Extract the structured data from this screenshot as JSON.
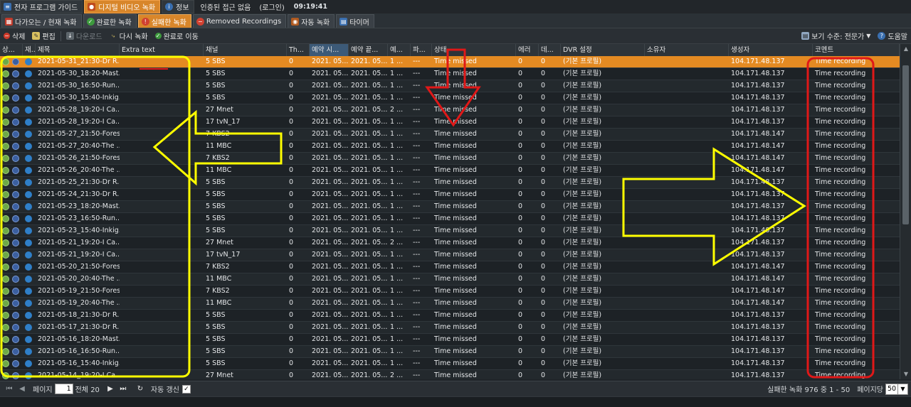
{
  "topnav": {
    "items": [
      {
        "label": "전자 프로그램 가이드",
        "icon": "tv-guide-icon",
        "active": false
      },
      {
        "label": "디지털 비디오 녹화",
        "icon": "dvr-icon",
        "active": true
      },
      {
        "label": "정보",
        "icon": "info-icon",
        "active": false
      }
    ],
    "auth_status": "인증된 접근 없음",
    "login_label": "(로그인)",
    "clock": "09:19:41"
  },
  "subtabs": [
    {
      "label": "다가오는 / 현재 녹화",
      "icon": "calendar-icon",
      "active": false
    },
    {
      "label": "완료한 녹화",
      "icon": "check-icon",
      "active": false
    },
    {
      "label": "실패한 녹화",
      "icon": "warning-icon",
      "active": true
    },
    {
      "label": "Removed Recordings",
      "icon": "removed-icon",
      "active": false
    },
    {
      "label": "자동 녹화",
      "icon": "autorec-icon",
      "active": false
    },
    {
      "label": "타이머",
      "icon": "timer-icon",
      "active": false
    }
  ],
  "toolbar": {
    "delete": "삭제",
    "edit": "편집",
    "download": "다운로드",
    "rerecord": "다시 녹화",
    "move_completed": "완료로 이동",
    "view_level": "보기 수준: 전문가",
    "help": "도움말"
  },
  "columns": [
    {
      "key": "status",
      "label": "상..."
    },
    {
      "key": "rec",
      "label": "재..."
    },
    {
      "key": "title",
      "label": "제목"
    },
    {
      "key": "extra",
      "label": "Extra text"
    },
    {
      "key": "channel",
      "label": "채널"
    },
    {
      "key": "th",
      "label": "Th..."
    },
    {
      "key": "start",
      "label": "예약 시..."
    },
    {
      "key": "end",
      "label": "예약 끝..."
    },
    {
      "key": "c9",
      "label": "예..."
    },
    {
      "key": "c10",
      "label": "파..."
    },
    {
      "key": "status_text",
      "label": "상태"
    },
    {
      "key": "err",
      "label": "에러"
    },
    {
      "key": "data",
      "label": "데..."
    },
    {
      "key": "dvr",
      "label": "DVR 설정"
    },
    {
      "key": "owner",
      "label": "소유자"
    },
    {
      "key": "creator",
      "label": "생성자"
    },
    {
      "key": "comment",
      "label": "코멘트"
    }
  ],
  "rows": [
    {
      "title": "2021-05-31_21:30-Dr R...",
      "channel": "5 SBS",
      "th": "0",
      "start": "2021. 05...",
      "end": "2021. 05...",
      "c9": "1 ...",
      "c10": "---",
      "status": "Time missed",
      "err": "0",
      "data": "0",
      "dvr": "(기본 프로필)",
      "creator": "104.171.48.137",
      "comment": "Time recording",
      "selected": true
    },
    {
      "title": "2021-05-30_18:20-Mast...",
      "channel": "5 SBS",
      "th": "0",
      "start": "2021. 05...",
      "end": "2021. 05...",
      "c9": "1 ...",
      "c10": "---",
      "status": "Time missed",
      "err": "0",
      "data": "0",
      "dvr": "(기본 프로필)",
      "creator": "104.171.48.137",
      "comment": "Time recording"
    },
    {
      "title": "2021-05-30_16:50-Run...",
      "channel": "5 SBS",
      "th": "0",
      "start": "2021. 05...",
      "end": "2021. 05...",
      "c9": "1 ...",
      "c10": "---",
      "status": "Time missed",
      "err": "0",
      "data": "0",
      "dvr": "(기본 프로필)",
      "creator": "104.171.48.137",
      "comment": "Time recording"
    },
    {
      "title": "2021-05-30_15:40-Inkig...",
      "channel": "5 SBS",
      "th": "0",
      "start": "2021. 05...",
      "end": "2021. 05...",
      "c9": "1 ...",
      "c10": "---",
      "status": "Time missed",
      "err": "0",
      "data": "0",
      "dvr": "(기본 프로필)",
      "creator": "104.171.48.137",
      "comment": "Time recording"
    },
    {
      "title": "2021-05-28_19:20-I Ca...",
      "channel": "27 Mnet",
      "th": "0",
      "start": "2021. 05...",
      "end": "2021. 05...",
      "c9": "2 ...",
      "c10": "---",
      "status": "Time missed",
      "err": "0",
      "data": "0",
      "dvr": "(기본 프로필)",
      "creator": "104.171.48.137",
      "comment": "Time recording"
    },
    {
      "title": "2021-05-28_19:20-I Ca...",
      "channel": "17 tvN_17",
      "th": "0",
      "start": "2021. 05...",
      "end": "2021. 05...",
      "c9": "1 ...",
      "c10": "---",
      "status": "Time missed",
      "err": "0",
      "data": "0",
      "dvr": "(기본 프로필)",
      "creator": "104.171.48.137",
      "comment": "Time recording"
    },
    {
      "title": "2021-05-27_21:50-Forest",
      "channel": "7 KBS2",
      "th": "0",
      "start": "2021. 05...",
      "end": "2021. 05...",
      "c9": "1 ...",
      "c10": "---",
      "status": "Time missed",
      "err": "0",
      "data": "0",
      "dvr": "(기본 프로필)",
      "creator": "104.171.48.147",
      "comment": "Time recording"
    },
    {
      "title": "2021-05-27_20:40-The ...",
      "channel": "11 MBC",
      "th": "0",
      "start": "2021. 05...",
      "end": "2021. 05...",
      "c9": "1 ...",
      "c10": "---",
      "status": "Time missed",
      "err": "0",
      "data": "0",
      "dvr": "(기본 프로필)",
      "creator": "104.171.48.147",
      "comment": "Time recording"
    },
    {
      "title": "2021-05-26_21:50-Forest",
      "channel": "7 KBS2",
      "th": "0",
      "start": "2021. 05...",
      "end": "2021. 05...",
      "c9": "1 ...",
      "c10": "---",
      "status": "Time missed",
      "err": "0",
      "data": "0",
      "dvr": "(기본 프로필)",
      "creator": "104.171.48.147",
      "comment": "Time recording"
    },
    {
      "title": "2021-05-26_20:40-The ...",
      "channel": "11 MBC",
      "th": "0",
      "start": "2021. 05...",
      "end": "2021. 05...",
      "c9": "1 ...",
      "c10": "---",
      "status": "Time missed",
      "err": "0",
      "data": "0",
      "dvr": "(기본 프로필)",
      "creator": "104.171.48.147",
      "comment": "Time recording"
    },
    {
      "title": "2021-05-25_21:30-Dr R...",
      "channel": "5 SBS",
      "th": "0",
      "start": "2021. 05...",
      "end": "2021. 05...",
      "c9": "1 ...",
      "c10": "---",
      "status": "Time missed",
      "err": "0",
      "data": "0",
      "dvr": "(기본 프로필)",
      "creator": "104.171.48.137",
      "comment": "Time recording"
    },
    {
      "title": "2021-05-24_21:30-Dr R...",
      "channel": "5 SBS",
      "th": "0",
      "start": "2021. 05...",
      "end": "2021. 05...",
      "c9": "1 ...",
      "c10": "---",
      "status": "Time missed",
      "err": "0",
      "data": "0",
      "dvr": "(기본 프로필)",
      "creator": "104.171.48.137",
      "comment": "Time recording"
    },
    {
      "title": "2021-05-23_18:20-Mast...",
      "channel": "5 SBS",
      "th": "0",
      "start": "2021. 05...",
      "end": "2021. 05...",
      "c9": "1 ...",
      "c10": "---",
      "status": "Time missed",
      "err": "0",
      "data": "0",
      "dvr": "(기본 프로필)",
      "creator": "104.171.48.137",
      "comment": "Time recording"
    },
    {
      "title": "2021-05-23_16:50-Run...",
      "channel": "5 SBS",
      "th": "0",
      "start": "2021. 05...",
      "end": "2021. 05...",
      "c9": "1 ...",
      "c10": "---",
      "status": "Time missed",
      "err": "0",
      "data": "0",
      "dvr": "(기본 프로필)",
      "creator": "104.171.48.137",
      "comment": "Time recording"
    },
    {
      "title": "2021-05-23_15:40-Inkig...",
      "channel": "5 SBS",
      "th": "0",
      "start": "2021. 05...",
      "end": "2021. 05...",
      "c9": "1 ...",
      "c10": "---",
      "status": "Time missed",
      "err": "0",
      "data": "0",
      "dvr": "(기본 프로필)",
      "creator": "104.171.48.137",
      "comment": "Time recording"
    },
    {
      "title": "2021-05-21_19:20-I Ca...",
      "channel": "27 Mnet",
      "th": "0",
      "start": "2021. 05...",
      "end": "2021. 05...",
      "c9": "2 ...",
      "c10": "---",
      "status": "Time missed",
      "err": "0",
      "data": "0",
      "dvr": "(기본 프로필)",
      "creator": "104.171.48.137",
      "comment": "Time recording"
    },
    {
      "title": "2021-05-21_19:20-I Ca...",
      "channel": "17 tvN_17",
      "th": "0",
      "start": "2021. 05...",
      "end": "2021. 05...",
      "c9": "1 ...",
      "c10": "---",
      "status": "Time missed",
      "err": "0",
      "data": "0",
      "dvr": "(기본 프로필)",
      "creator": "104.171.48.137",
      "comment": "Time recording"
    },
    {
      "title": "2021-05-20_21:50-Forest",
      "channel": "7 KBS2",
      "th": "0",
      "start": "2021. 05...",
      "end": "2021. 05...",
      "c9": "1 ...",
      "c10": "---",
      "status": "Time missed",
      "err": "0",
      "data": "0",
      "dvr": "(기본 프로필)",
      "creator": "104.171.48.147",
      "comment": "Time recording"
    },
    {
      "title": "2021-05-20_20:40-The ...",
      "channel": "11 MBC",
      "th": "0",
      "start": "2021. 05...",
      "end": "2021. 05...",
      "c9": "1 ...",
      "c10": "---",
      "status": "Time missed",
      "err": "0",
      "data": "0",
      "dvr": "(기본 프로필)",
      "creator": "104.171.48.147",
      "comment": "Time recording"
    },
    {
      "title": "2021-05-19_21:50-Forest",
      "channel": "7 KBS2",
      "th": "0",
      "start": "2021. 05...",
      "end": "2021. 05...",
      "c9": "1 ...",
      "c10": "---",
      "status": "Time missed",
      "err": "0",
      "data": "0",
      "dvr": "(기본 프로필)",
      "creator": "104.171.48.147",
      "comment": "Time recording"
    },
    {
      "title": "2021-05-19_20:40-The ...",
      "channel": "11 MBC",
      "th": "0",
      "start": "2021. 05...",
      "end": "2021. 05...",
      "c9": "1 ...",
      "c10": "---",
      "status": "Time missed",
      "err": "0",
      "data": "0",
      "dvr": "(기본 프로필)",
      "creator": "104.171.48.147",
      "comment": "Time recording"
    },
    {
      "title": "2021-05-18_21:30-Dr R...",
      "channel": "5 SBS",
      "th": "0",
      "start": "2021. 05...",
      "end": "2021. 05...",
      "c9": "1 ...",
      "c10": "---",
      "status": "Time missed",
      "err": "0",
      "data": "0",
      "dvr": "(기본 프로필)",
      "creator": "104.171.48.137",
      "comment": "Time recording"
    },
    {
      "title": "2021-05-17_21:30-Dr R...",
      "channel": "5 SBS",
      "th": "0",
      "start": "2021. 05...",
      "end": "2021. 05...",
      "c9": "1 ...",
      "c10": "---",
      "status": "Time missed",
      "err": "0",
      "data": "0",
      "dvr": "(기본 프로필)",
      "creator": "104.171.48.137",
      "comment": "Time recording"
    },
    {
      "title": "2021-05-16_18:20-Mast...",
      "channel": "5 SBS",
      "th": "0",
      "start": "2021. 05...",
      "end": "2021. 05...",
      "c9": "1 ...",
      "c10": "---",
      "status": "Time missed",
      "err": "0",
      "data": "0",
      "dvr": "(기본 프로필)",
      "creator": "104.171.48.137",
      "comment": "Time recording"
    },
    {
      "title": "2021-05-16_16:50-Run...",
      "channel": "5 SBS",
      "th": "0",
      "start": "2021. 05...",
      "end": "2021. 05...",
      "c9": "1 ...",
      "c10": "---",
      "status": "Time missed",
      "err": "0",
      "data": "0",
      "dvr": "(기본 프로필)",
      "creator": "104.171.48.137",
      "comment": "Time recording"
    },
    {
      "title": "2021-05-16_15:40-Inkig...",
      "channel": "5 SBS",
      "th": "0",
      "start": "2021. 05...",
      "end": "2021. 05...",
      "c9": "1 ...",
      "c10": "---",
      "status": "Time missed",
      "err": "0",
      "data": "0",
      "dvr": "(기본 프로필)",
      "creator": "104.171.48.137",
      "comment": "Time recording"
    },
    {
      "title": "2021-05-14_19:20-I Ca...",
      "channel": "27 Mnet",
      "th": "0",
      "start": "2021. 05...",
      "end": "2021. 05...",
      "c9": "2 ...",
      "c10": "---",
      "status": "Time missed",
      "err": "0",
      "data": "0",
      "dvr": "(기본 프로필)",
      "creator": "104.171.48.137",
      "comment": "Time recording"
    }
  ],
  "footer": {
    "page_label": "페이지",
    "page_value": "1",
    "total_label": "전체 20",
    "auto_refresh": "자동 갱신",
    "auto_refresh_checked": true,
    "summary": "실패한 녹화 976 중 1 - 50",
    "per_page_label": "페이지당",
    "per_page_value": "50"
  },
  "colors": {
    "accent": "#d8862a",
    "selected_row": "#e48a22",
    "annotation_yellow": "#ffff00",
    "annotation_red": "#e01818"
  }
}
